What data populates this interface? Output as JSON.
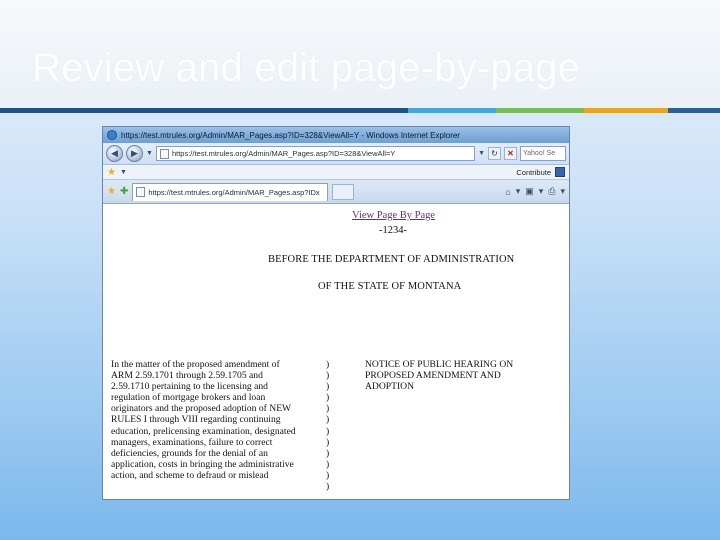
{
  "slide": {
    "title": "Review and edit page-by-page"
  },
  "browser": {
    "title_text": "https://test.mtrules.org/Admin/MAR_Pages.asp?ID=328&ViewAll=Y - Windows Internet Explorer",
    "address": "https://test.mtrules.org/Admin/MAR_Pages.asp?ID=328&ViewAll=Y",
    "search_placeholder": "Yahoo! Se",
    "contribute_label": "Contribute",
    "tab_text": "https://test.mtrules.org/Admin/MAR_Pages.asp?IDx",
    "icons": {
      "back": "back-arrow-icon",
      "forward": "forward-arrow-icon",
      "refresh": "refresh-icon",
      "stop": "stop-icon",
      "favorites": "star-icon",
      "home": "home-icon",
      "feeds": "rss-icon",
      "print": "print-icon"
    }
  },
  "document": {
    "view_link": "View Page By Page",
    "number": "-1234-",
    "dept_line1": "BEFORE THE DEPARTMENT OF ADMINISTRATION",
    "dept_line2": "OF THE STATE OF MONTANA",
    "matter_lines": [
      "In the matter of the proposed amendment of",
      "ARM 2.59.1701 through 2.59.1705 and",
      "2.59.1710 pertaining to the licensing and",
      "regulation of mortgage brokers and loan",
      "originators and the proposed adoption of NEW",
      "RULES I through VIII regarding continuing",
      "education, prelicensing examination, designated",
      "managers, examinations, failure to correct",
      "deficiencies, grounds for the denial of an",
      "application, costs in bringing the administrative",
      "action, and scheme to defraud or mislead"
    ],
    "paren_lines": [
      ")",
      ")",
      ")",
      ")",
      ")",
      ")",
      ")",
      ")",
      ")",
      ")",
      ")",
      ")"
    ],
    "notice_lines": [
      "NOTICE OF PUBLIC HEARING ON",
      "PROPOSED AMENDMENT AND",
      "ADOPTION"
    ]
  }
}
